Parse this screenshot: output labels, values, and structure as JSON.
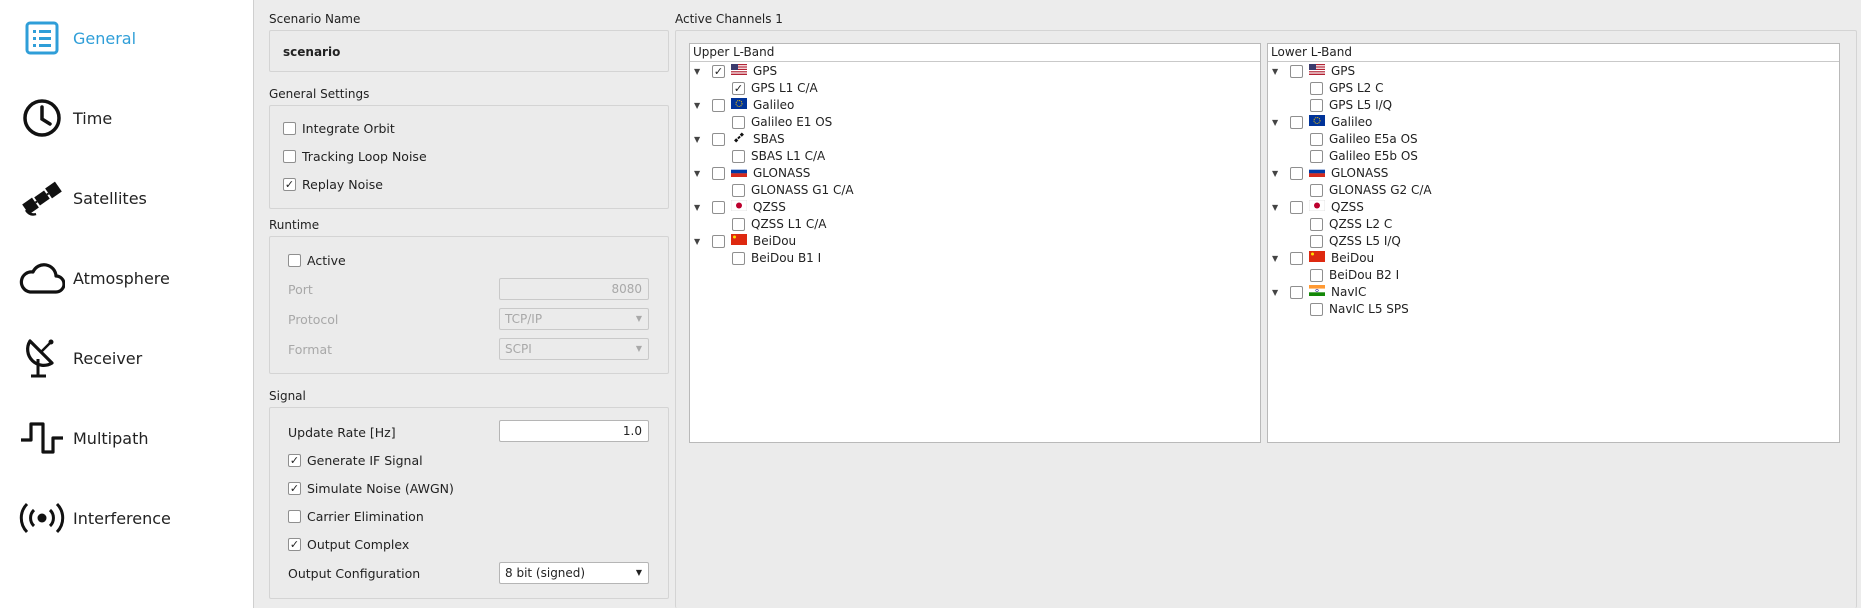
{
  "sidebar": {
    "items": [
      {
        "label": "General",
        "icon": "list-icon",
        "active": true
      },
      {
        "label": "Time",
        "icon": "clock-icon"
      },
      {
        "label": "Satellites",
        "icon": "satellite-icon"
      },
      {
        "label": "Atmosphere",
        "icon": "cloud-icon"
      },
      {
        "label": "Receiver",
        "icon": "dish-icon"
      },
      {
        "label": "Multipath",
        "icon": "multipath-icon"
      },
      {
        "label": "Interference",
        "icon": "broadcast-icon"
      }
    ],
    "accent_color": "#2f9ed8"
  },
  "scenario": {
    "title": "Scenario Name",
    "value": "scenario"
  },
  "general_settings": {
    "title": "General Settings",
    "integrate_orbit": {
      "label": "Integrate Orbit",
      "checked": false
    },
    "tracking_loop_noise": {
      "label": "Tracking Loop Noise",
      "checked": false
    },
    "replay_noise": {
      "label": "Replay Noise",
      "checked": true
    }
  },
  "runtime": {
    "title": "Runtime",
    "active": {
      "label": "Active",
      "checked": false
    },
    "port_label": "Port",
    "port_value": "8080",
    "protocol_label": "Protocol",
    "protocol_value": "TCP/IP",
    "format_label": "Format",
    "format_value": "SCPI"
  },
  "signal": {
    "title": "Signal",
    "update_rate_label": "Update Rate [Hz]",
    "update_rate_value": "1.0",
    "generate_if": {
      "label": "Generate IF Signal",
      "checked": true
    },
    "simulate_noise": {
      "label": "Simulate Noise (AWGN)",
      "checked": true
    },
    "carrier_elim": {
      "label": "Carrier Elimination",
      "checked": false
    },
    "output_complex": {
      "label": "Output Complex",
      "checked": true
    },
    "output_config_label": "Output Configuration",
    "output_config_value": "8 bit (signed)"
  },
  "channels": {
    "title": "Active Channels 1",
    "upper": {
      "header": "Upper L-Band",
      "groups": [
        {
          "name": "GPS",
          "flag": "us",
          "checked": true,
          "signals": [
            {
              "name": "GPS L1 C/A",
              "checked": true
            }
          ]
        },
        {
          "name": "Galileo",
          "flag": "eu",
          "checked": false,
          "signals": [
            {
              "name": "Galileo E1 OS",
              "checked": false
            }
          ]
        },
        {
          "name": "SBAS",
          "flag": "sbas",
          "checked": false,
          "signals": [
            {
              "name": "SBAS L1 C/A",
              "checked": false
            }
          ]
        },
        {
          "name": "GLONASS",
          "flag": "ru",
          "checked": false,
          "signals": [
            {
              "name": "GLONASS G1 C/A",
              "checked": false
            }
          ]
        },
        {
          "name": "QZSS",
          "flag": "jp",
          "checked": false,
          "signals": [
            {
              "name": "QZSS L1 C/A",
              "checked": false
            }
          ]
        },
        {
          "name": "BeiDou",
          "flag": "cn",
          "checked": false,
          "signals": [
            {
              "name": "BeiDou B1 I",
              "checked": false
            }
          ]
        }
      ]
    },
    "lower": {
      "header": "Lower L-Band",
      "groups": [
        {
          "name": "GPS",
          "flag": "us",
          "checked": false,
          "signals": [
            {
              "name": "GPS L2 C",
              "checked": false
            },
            {
              "name": "GPS L5 I/Q",
              "checked": false
            }
          ]
        },
        {
          "name": "Galileo",
          "flag": "eu",
          "checked": false,
          "signals": [
            {
              "name": "Galileo E5a OS",
              "checked": false
            },
            {
              "name": "Galileo E5b OS",
              "checked": false
            }
          ]
        },
        {
          "name": "GLONASS",
          "flag": "ru",
          "checked": false,
          "signals": [
            {
              "name": "GLONASS G2 C/A",
              "checked": false
            }
          ]
        },
        {
          "name": "QZSS",
          "flag": "jp",
          "checked": false,
          "signals": [
            {
              "name": "QZSS L2 C",
              "checked": false
            },
            {
              "name": "QZSS L5 I/Q",
              "checked": false
            }
          ]
        },
        {
          "name": "BeiDou",
          "flag": "cn",
          "checked": false,
          "signals": [
            {
              "name": "BeiDou B2 I",
              "checked": false
            }
          ]
        },
        {
          "name": "NavIC",
          "flag": "in",
          "checked": false,
          "signals": [
            {
              "name": "NavIC L5 SPS",
              "checked": false
            }
          ]
        }
      ]
    }
  }
}
